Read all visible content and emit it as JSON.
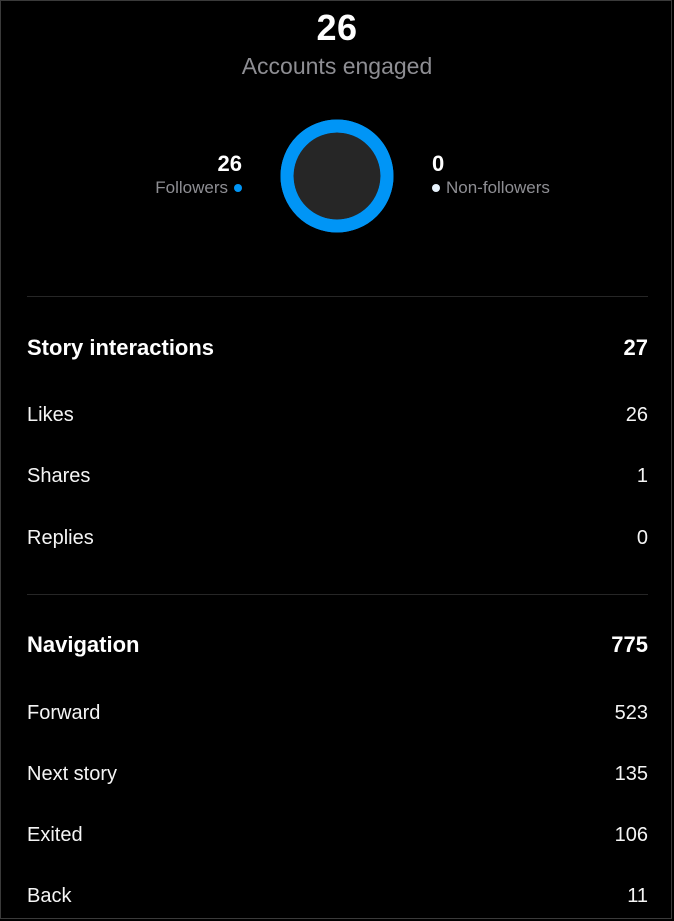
{
  "summary": {
    "accounts_engaged_value": "26",
    "accounts_engaged_label": "Accounts engaged"
  },
  "breakdown": {
    "followers": {
      "value": "26",
      "label": "Followers",
      "color": "#0095f6",
      "fraction": 1.0
    },
    "non_followers": {
      "value": "0",
      "label": "Non-followers",
      "color": "#e6f1fb",
      "fraction": 0.0
    },
    "donut_center_color": "#262626"
  },
  "story_interactions": {
    "title": "Story interactions",
    "total": "27",
    "items": [
      {
        "label": "Likes",
        "value": "26"
      },
      {
        "label": "Shares",
        "value": "1"
      },
      {
        "label": "Replies",
        "value": "0"
      }
    ]
  },
  "navigation": {
    "title": "Navigation",
    "total": "775",
    "items": [
      {
        "label": "Forward",
        "value": "523"
      },
      {
        "label": "Next story",
        "value": "135"
      },
      {
        "label": "Exited",
        "value": "106"
      },
      {
        "label": "Back",
        "value": "11"
      }
    ]
  }
}
